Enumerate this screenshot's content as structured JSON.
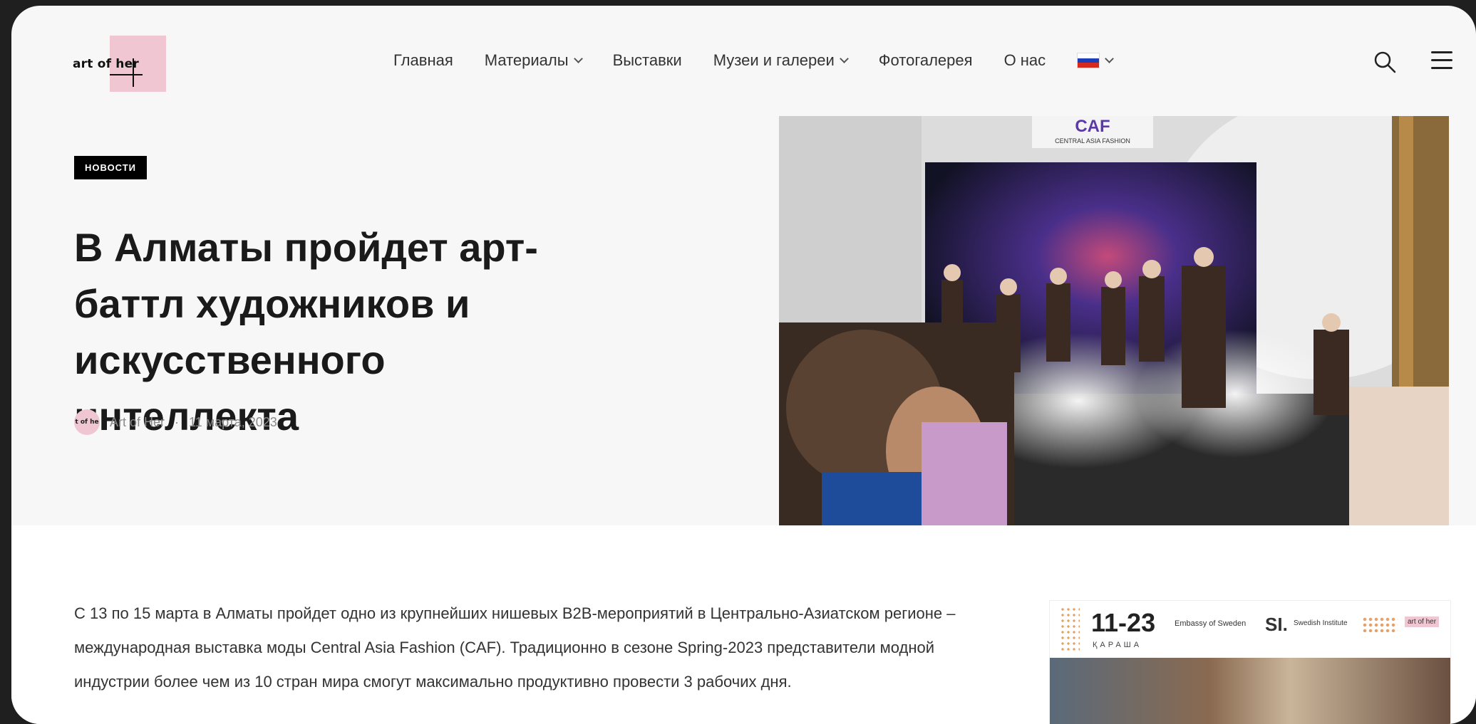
{
  "header": {
    "logo_text": "art of her",
    "nav": [
      {
        "label": "Главная",
        "dropdown": false
      },
      {
        "label": "Материалы",
        "dropdown": true
      },
      {
        "label": "Выставки",
        "dropdown": false
      },
      {
        "label": "Музеи и галереи",
        "dropdown": true
      },
      {
        "label": "Фотогалерея",
        "dropdown": false
      },
      {
        "label": "О нас",
        "dropdown": false
      }
    ],
    "language_flag": "ru-flag",
    "icons": {
      "search": "search-icon",
      "menu": "hamburger-menu-icon"
    }
  },
  "hero": {
    "category_badge": "НОВОСТИ",
    "title": "В Алматы пройдет арт-баттл художников и искусственного интеллекта",
    "author_avatar_text": "t of he",
    "author": "Art of Her",
    "separator": "·",
    "date": "11 марта, 2023",
    "image_banner_text": "CENTRAL ASIA FASHION",
    "image_logo_text": "CAF"
  },
  "article": {
    "paragraph": "С 13 по 15 марта в Алматы пройдет одно из крупнейших нишевых B2B-мероприятий в Центрально-Азиатском регионе – международная выставка моды Central Asia Fashion (CAF). Традиционно в сезоне Spring-2023 представители модной индустрии более чем из 10 стран мира смогут максимально продуктивно провести 3 рабочих дня."
  },
  "side_ad": {
    "dates": "11-23",
    "month": "ҚАРАША",
    "partner_1": "Embassy of Sweden",
    "partner_2_mark": "SI.",
    "partner_2": "Swedish Institute",
    "partner_4": "art of her"
  },
  "colors": {
    "brand_pink": "#f0c6d3",
    "badge_bg": "#000000",
    "page_bg": "#f7f7f7"
  }
}
